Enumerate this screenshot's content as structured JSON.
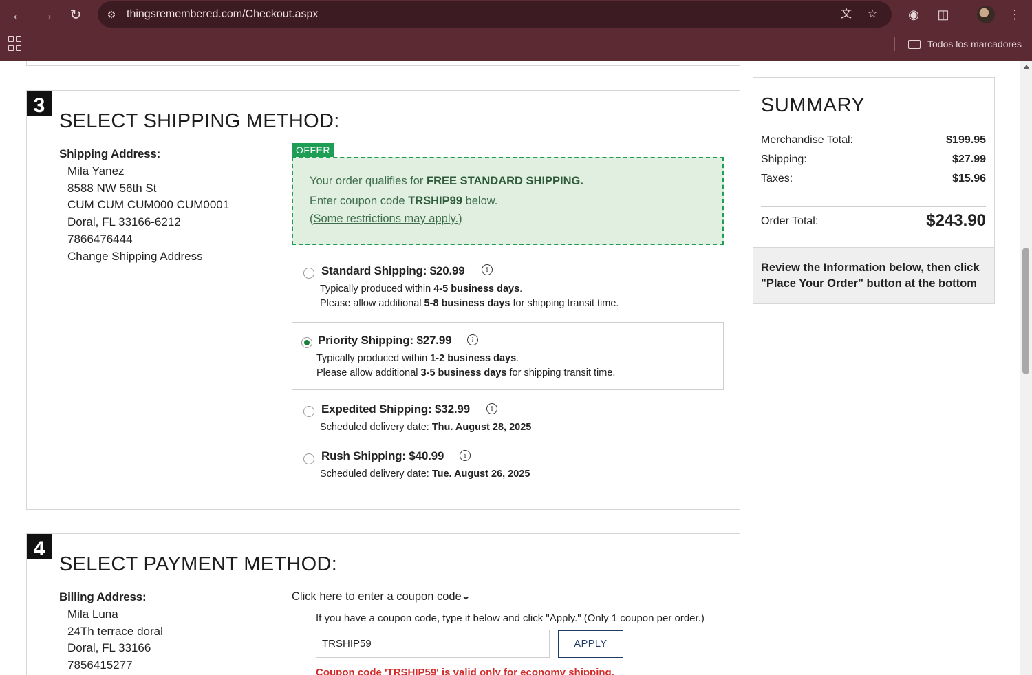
{
  "browser": {
    "url": "thingsremembered.com/Checkout.aspx",
    "bookmarks_folder": "Todos los marcadores",
    "icons": [
      "back-icon",
      "forward-icon",
      "reload-icon",
      "site-settings-icon",
      "translate-icon",
      "star-icon",
      "extension-badge-icon",
      "puzzle-icon",
      "menu-dots-icon",
      "apps-grid-icon",
      "folder-icon"
    ]
  },
  "shipping_step": {
    "number": "3",
    "title": "SELECT SHIPPING METHOD:",
    "address_header": "Shipping Address:",
    "address_lines": [
      "Mila Yanez",
      "8588 NW 56th St",
      "CUM CUM CUM000 CUM0001",
      "Doral, FL 33166-6212",
      "7866476444"
    ],
    "change_link": "Change Shipping Address",
    "offer": {
      "tag": "OFFER",
      "line1_prefix": "Your order qualifies for ",
      "line1_bold": "FREE STANDARD SHIPPING.",
      "line2_prefix": "Enter coupon code ",
      "line2_code": "TRSHIP99",
      "line2_suffix": " below.",
      "line3_open": "(",
      "line3_link": "Some restrictions may apply.",
      "line3_close": ")"
    },
    "options": [
      {
        "title": "Standard Shipping: $20.99",
        "selected": false,
        "l1_prefix": "Typically produced within ",
        "l1_bold": "4-5 business days",
        "l1_suffix": ".",
        "l2_prefix": "Please allow additional ",
        "l2_bold": "5-8 business days",
        "l2_suffix": " for shipping transit time."
      },
      {
        "title": "Priority Shipping: $27.99",
        "selected": true,
        "l1_prefix": "Typically produced within ",
        "l1_bold": "1-2 business days",
        "l1_suffix": ".",
        "l2_prefix": "Please allow additional ",
        "l2_bold": "3-5 business days",
        "l2_suffix": " for shipping transit time."
      },
      {
        "title": "Expedited Shipping: $32.99",
        "selected": false,
        "l1_prefix": "Scheduled delivery date: ",
        "l1_bold": "Thu. August 28, 2025"
      },
      {
        "title": "Rush Shipping: $40.99",
        "selected": false,
        "l1_prefix": "Scheduled delivery date: ",
        "l1_bold": "Tue. August 26, 2025"
      }
    ],
    "info_glyph": "i"
  },
  "payment_step": {
    "number": "4",
    "title": "SELECT PAYMENT METHOD:",
    "address_header": "Billing Address:",
    "address_lines": [
      "Mila Luna",
      "24Th terrace doral",
      "Doral, FL 33166",
      "7856415277"
    ],
    "coupon_link": "Click here to enter a coupon code",
    "coupon_help": "If you have a coupon code, type it below and click \"Apply.\" (Only 1 coupon per order.)",
    "coupon_value": "TRSHIP59",
    "apply_label": "APPLY",
    "coupon_error": "Coupon code 'TRSHIP59' is valid only for economy shipping."
  },
  "summary": {
    "title": "SUMMARY",
    "merchandise_label": "Merchandise Total:",
    "merchandise_value": "$199.95",
    "shipping_label": "Shipping:",
    "shipping_value": "$27.99",
    "taxes_label": "Taxes:",
    "taxes_value": "$15.96",
    "total_label": "Order Total:",
    "total_value": "$243.90",
    "note": "Review the Information below, then click \"Place Your Order\" button at the bottom"
  },
  "colors": {
    "chrome": "#5b2a33",
    "offer_green": "#1e9e55",
    "offer_bg": "#e0efe0",
    "apply_navy": "#1f3b63",
    "error_red": "#d32a2a",
    "radio_selected": "#1a7f3a"
  }
}
